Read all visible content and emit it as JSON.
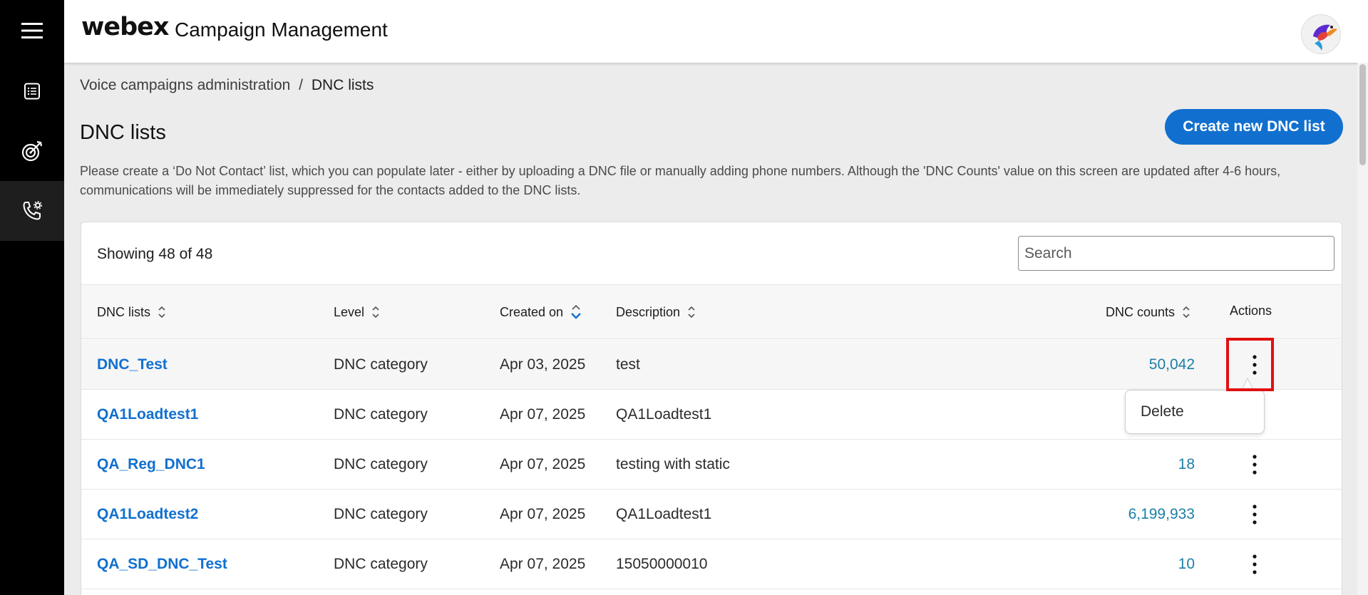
{
  "app": {
    "logo": "webex",
    "title": "Campaign Management"
  },
  "sidebar": {
    "items": [
      {
        "icon": "hamburger-menu-icon"
      },
      {
        "icon": "list-icon"
      },
      {
        "icon": "target-icon"
      },
      {
        "icon": "phone-settings-icon",
        "active": true
      }
    ]
  },
  "breadcrumb": {
    "parent": "Voice campaigns administration",
    "separator": "/",
    "current": "DNC lists"
  },
  "page": {
    "title": "DNC lists",
    "create_button": "Create new DNC list",
    "description": "Please create a ‘Do Not Contact’ list, which you can populate later - either by uploading a DNC file or manually adding phone numbers. Although the 'DNC Counts' value on this screen are updated after 4-6 hours, communications will be immediately suppressed for the contacts added to the DNC lists."
  },
  "table": {
    "showing": "Showing 48 of 48",
    "search_placeholder": "Search",
    "columns": {
      "name": "DNC lists",
      "level": "Level",
      "created": "Created on",
      "description": "Description",
      "counts": "DNC counts",
      "actions": "Actions"
    },
    "sorted_column": "created",
    "rows": [
      {
        "name": "DNC_Test",
        "level": "DNC category",
        "created": "Apr 03, 2025",
        "description": "test",
        "count": "50,042"
      },
      {
        "name": "QA1Loadtest1",
        "level": "DNC category",
        "created": "Apr 07, 2025",
        "description": "QA1Loadtest1",
        "count": ""
      },
      {
        "name": "QA_Reg_DNC1",
        "level": "DNC category",
        "created": "Apr 07, 2025",
        "description": "testing with static",
        "count": "18"
      },
      {
        "name": "QA1Loadtest2",
        "level": "DNC category",
        "created": "Apr 07, 2025",
        "description": "QA1Loadtest1",
        "count": "6,199,933"
      },
      {
        "name": "QA_SD_DNC_Test",
        "level": "DNC category",
        "created": "Apr 07, 2025",
        "description": "15050000010",
        "count": "10"
      }
    ]
  },
  "action_menu": {
    "items": [
      "Delete"
    ]
  },
  "colors": {
    "accent": "#1170cf",
    "count_text": "#1b7fa5",
    "highlight_box": "#e01010",
    "sidebar_bg": "#000000"
  }
}
